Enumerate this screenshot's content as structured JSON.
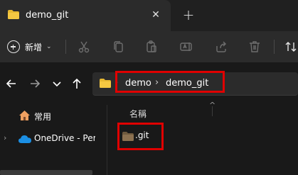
{
  "window": {
    "tab_title": "demo_git",
    "close_glyph": "✕",
    "new_tab_glyph": "+"
  },
  "toolbar": {
    "new_label": "新增",
    "new_chevron": "⌄",
    "icons": [
      "cut-icon",
      "copy-icon",
      "paste-icon",
      "rename-icon",
      "share-icon",
      "delete-icon",
      "sort-icon"
    ]
  },
  "navigation": {
    "back": "back-arrow-icon",
    "forward": "forward-arrow-icon",
    "recent": "chevron-down-icon",
    "up": "up-arrow-icon"
  },
  "address": {
    "separator": "›",
    "crumbs": [
      "demo",
      "demo_git"
    ]
  },
  "sidebar": {
    "items": [
      {
        "label": "常用",
        "icon": "home-icon"
      },
      {
        "label": "OneDrive - Pers",
        "icon": "onedrive-cloud-icon",
        "expand": "›"
      }
    ]
  },
  "file_list": {
    "column_name": "名稱",
    "sort_caret": "^",
    "files": [
      {
        "name": ".git",
        "icon": "folder-icon"
      }
    ]
  },
  "colors": {
    "background": "#191919",
    "toolbar": "#2b2b2b",
    "folder_yellow": "#e8b931",
    "folder_git_brown": "#8c7150",
    "highlight_red": "#e00000",
    "onedrive_blue": "#1b8fe4"
  }
}
